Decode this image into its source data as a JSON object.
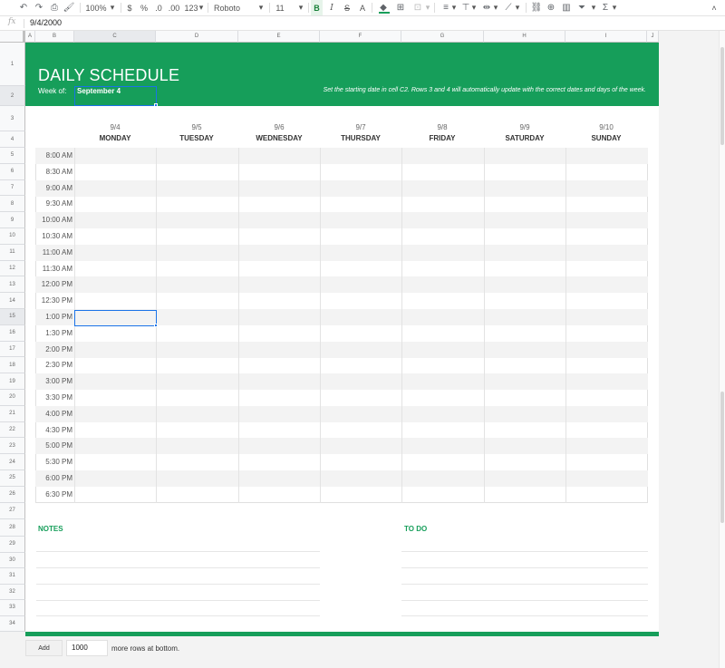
{
  "toolbar": {
    "zoom": "100%",
    "currency": "$",
    "percent": "%",
    "decrease_decimal": ".0",
    "increase_decimal": ".00",
    "number_format": "123",
    "font": "Roboto",
    "font_size": "11",
    "bold": "B",
    "italic": "I",
    "strikethrough": "S",
    "text_color": "A",
    "fill_color": "#169e5a"
  },
  "formula_bar": {
    "fx": "fx",
    "value": "9/4/2000"
  },
  "columns": [
    "A",
    "B",
    "C",
    "D",
    "E",
    "F",
    "G",
    "H",
    "I",
    "J"
  ],
  "rows": [
    "1",
    "2",
    "3",
    "4",
    "5",
    "6",
    "7",
    "8",
    "9",
    "10",
    "11",
    "12",
    "13",
    "14",
    "15",
    "16",
    "17",
    "18",
    "19",
    "20",
    "21",
    "22",
    "23",
    "24",
    "25",
    "26",
    "27",
    "28",
    "29",
    "30",
    "31",
    "32",
    "33",
    "34"
  ],
  "header": {
    "title": "DAILY SCHEDULE",
    "week_of_label": "Week of:",
    "week_of_value": "September 4",
    "instruction": "Set the starting date in cell C2. Rows 3 and 4 will automatically update with the correct dates and days of the week."
  },
  "days": [
    {
      "date": "9/4",
      "name": "MONDAY"
    },
    {
      "date": "9/5",
      "name": "TUESDAY"
    },
    {
      "date": "9/6",
      "name": "WEDNESDAY"
    },
    {
      "date": "9/7",
      "name": "THURSDAY"
    },
    {
      "date": "9/8",
      "name": "FRIDAY"
    },
    {
      "date": "9/9",
      "name": "SATURDAY"
    },
    {
      "date": "9/10",
      "name": "SUNDAY"
    }
  ],
  "times": [
    "8:00 AM",
    "8:30 AM",
    "9:00 AM",
    "9:30 AM",
    "10:00 AM",
    "10:30 AM",
    "11:00 AM",
    "11:30 AM",
    "12:00 PM",
    "12:30 PM",
    "1:00 PM",
    "1:30 PM",
    "2:00 PM",
    "2:30 PM",
    "3:00 PM",
    "3:30 PM",
    "4:00 PM",
    "4:30 PM",
    "5:00 PM",
    "5:30 PM",
    "6:00 PM",
    "6:30 PM"
  ],
  "sections": {
    "notes": "NOTES",
    "todo": "TO DO"
  },
  "footer": {
    "add_button": "Add",
    "rows_value": "1000",
    "rows_label": "more rows at bottom."
  },
  "colors": {
    "accent": "#169e5a",
    "selection": "#1a73e8"
  }
}
